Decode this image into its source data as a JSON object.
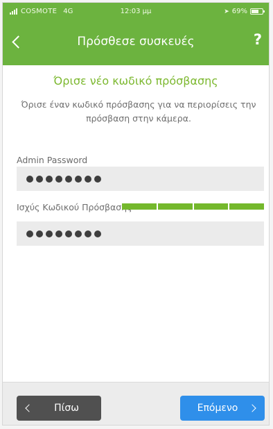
{
  "status_bar": {
    "carrier": "COSMOTE",
    "network": "4G",
    "time": "12:03 μμ",
    "battery": "69%",
    "battery_level": 0.69,
    "icons": [
      "signal-icon",
      "location-arrow-icon",
      "battery-icon"
    ]
  },
  "nav": {
    "title": "Πρόσθεσε συσκευές",
    "help_label": "?",
    "back_icon": "chevron-left-icon"
  },
  "content": {
    "heading": "Όρισε νέο κωδικό πρόσβασης",
    "description": "Όρισε έναν κωδικό πρόσβασης για να περιορίσεις την πρόσβαση στην κάμερα.",
    "password_label": "Admin Password",
    "password_value": "●●●●●●●●",
    "strength_label": "Ισχύς Κωδικού Πρόσβασης",
    "strength_level": 4,
    "strength_segments": 4,
    "confirm_value": "●●●●●●●●"
  },
  "footer": {
    "back_label": "Πίσω",
    "next_label": "Επόμενο"
  },
  "colors": {
    "header": "#6cb33f",
    "heading": "#7cb82f",
    "strength": "#74b82c",
    "back_button": "#505050",
    "next_button": "#2f8fea"
  }
}
